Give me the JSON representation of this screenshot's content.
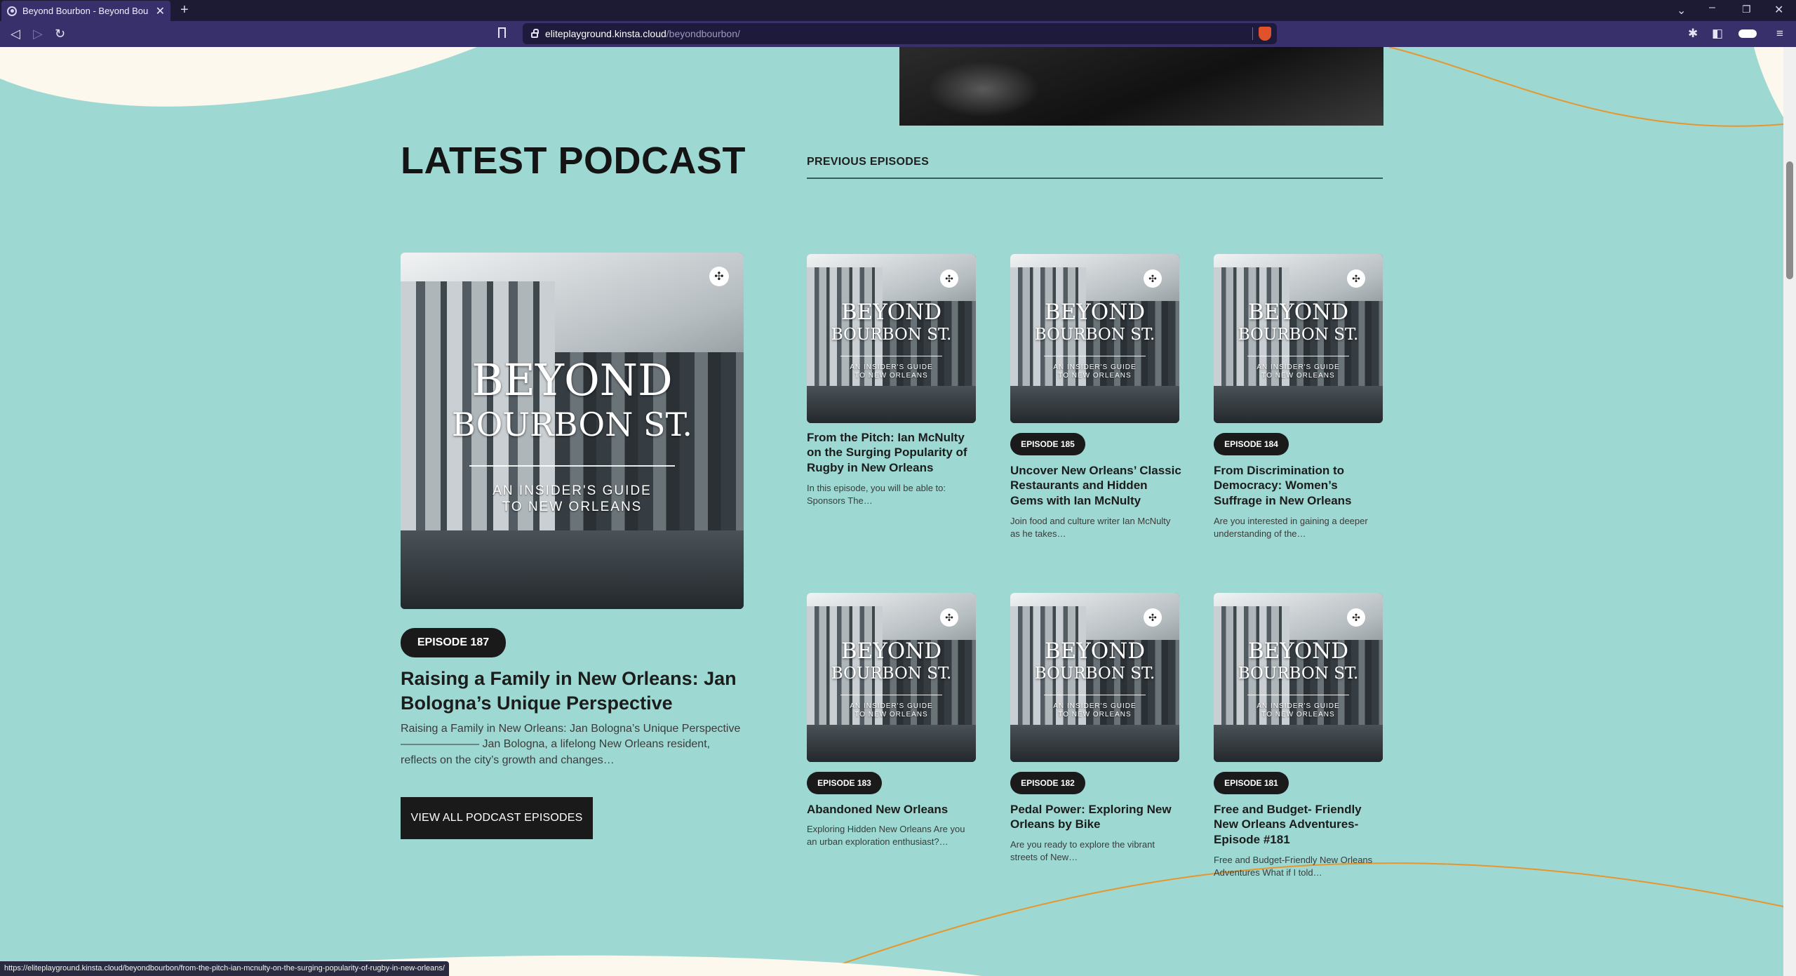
{
  "browser": {
    "tab_title": "Beyond Bourbon - Beyond Bourb",
    "url_host": "eliteplayground.kinsta.cloud",
    "url_path": "/beyondbourbon/",
    "status_url": "https://eliteplayground.kinsta.cloud/beyondbourbon/from-the-pitch-ian-mcnulty-on-the-surging-popularity-of-rugby-in-new-orleans/"
  },
  "cover_art": {
    "line1": "BEYOND",
    "line2": "BOURBON ST.",
    "tagline1": "AN INSIDER'S GUIDE",
    "tagline2": "TO NEW ORLEANS"
  },
  "latest": {
    "heading": "LATEST PODCAST",
    "badge": "EPISODE 187",
    "title": "Raising a Family in New Orleans: Jan Bologna’s Unique Perspective",
    "excerpt": "Raising a Family in New Orleans: Jan Bologna’s Unique Perspective ——————— Jan Bologna, a lifelong New Orleans resident, reflects on the city’s growth and changes…",
    "button": "VIEW ALL PODCAST EPISODES"
  },
  "previous": {
    "heading": "PREVIOUS EPISODES",
    "episodes": [
      {
        "badge": "",
        "title": "From the Pitch: Ian McNulty on the Surging Popularity of Rugby in New Orleans",
        "excerpt": "In this episode, you will be able to: Sponsors The…"
      },
      {
        "badge": "EPISODE 185",
        "title": "Uncover New Orleans’ Classic Restaurants and Hidden Gems with Ian McNulty",
        "excerpt": "Join food and culture writer Ian McNulty as he takes…"
      },
      {
        "badge": "EPISODE 184",
        "title": "From Discrimination to Democracy: Women’s Suffrage in New Orleans",
        "excerpt": "Are you interested in gaining a deeper understanding of the…"
      },
      {
        "badge": "EPISODE 183",
        "title": "Abandoned New Orleans",
        "excerpt": "Exploring Hidden New Orleans Are you an urban exploration enthusiast?…"
      },
      {
        "badge": "EPISODE 182",
        "title": "Pedal Power: Exploring New Orleans by Bike",
        "excerpt": "Are you ready to explore the vibrant streets of New…"
      },
      {
        "badge": "EPISODE 181",
        "title": "Free and Budget- Friendly New Orleans Adventures- Episode #181",
        "excerpt": "Free and Budget-Friendly New Orleans Adventures What if I told…"
      }
    ]
  },
  "colors": {
    "page_bg": "#9dd9d2",
    "cream": "#fdf8ee",
    "accent_line": "#e8952c",
    "dark": "#1a1a1a",
    "chrome": "#38306b"
  }
}
